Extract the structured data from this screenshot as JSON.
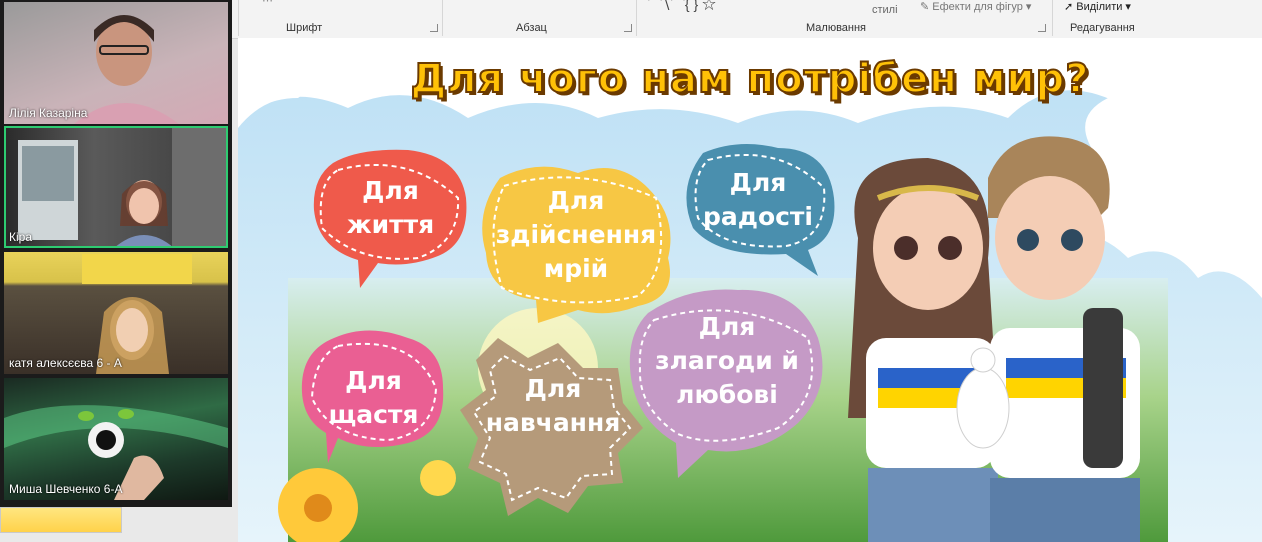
{
  "ribbon": {
    "groups": {
      "font": "Шрифт",
      "paragraph": "Абзац",
      "drawing": "Малювання",
      "editing": "Редагування"
    },
    "styles_label": "стилі",
    "shape_effects": "Ефекти для фігур",
    "select_label": "Виділити"
  },
  "participants": [
    {
      "name": "Лілія Казаріна"
    },
    {
      "name": "Кіра"
    },
    {
      "name": "катя алексєєва 6 - А"
    },
    {
      "name": "Миша Шевченко 6-А"
    }
  ],
  "slide": {
    "title": "Для чого нам потрібен мир?",
    "bubbles": [
      {
        "text": "Для\nжиття",
        "color": "#ef5a4b"
      },
      {
        "text": "Для\nздійснення\nмрій",
        "color": "#f7c744"
      },
      {
        "text": "Для\nрадості",
        "color": "#4a8fae"
      },
      {
        "text": "Для\nщастя",
        "color": "#ea5f93"
      },
      {
        "text": "Для\nнавчання",
        "color": "#b59a7a"
      },
      {
        "text": "Для\nзлагоди й\nлюбові",
        "color": "#c59ac6"
      }
    ]
  }
}
